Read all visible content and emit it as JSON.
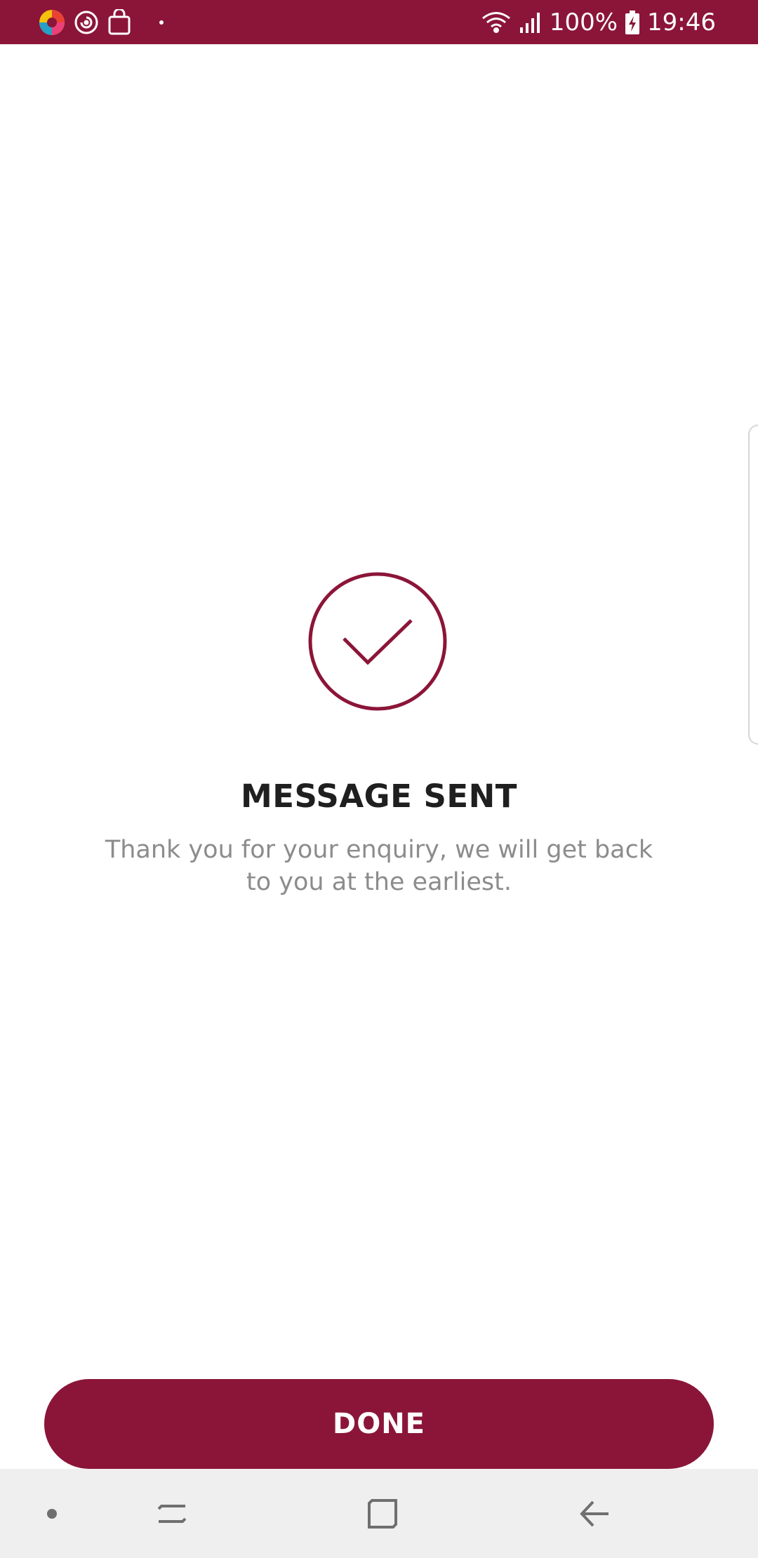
{
  "status_bar": {
    "battery": "100%",
    "time": "19:46",
    "icons": [
      "app-icon-colorful",
      "sync-icon",
      "shopping-bag-icon",
      "dot-icon",
      "wifi-icon",
      "signal-icon",
      "battery-charging-icon"
    ]
  },
  "confirmation": {
    "icon": "check-circle-icon",
    "title": "MESSAGE SENT",
    "line1": "Thank you for your enquiry, we will get back",
    "line2": "to you at the earliest."
  },
  "actions": {
    "done_label": "DONE"
  },
  "nav_bar": {
    "icons": [
      "dot-icon",
      "recents-icon",
      "home-icon",
      "back-icon"
    ]
  },
  "colors": {
    "brand": "#8b1538",
    "title": "#1f1f1f",
    "subtitle": "#8c8c8c",
    "nav_bg": "#efefef"
  }
}
